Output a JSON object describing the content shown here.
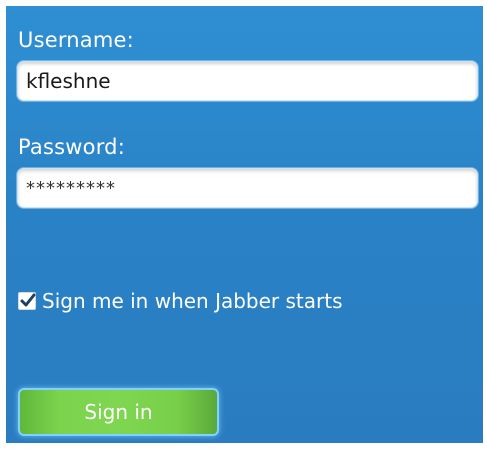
{
  "login": {
    "username_label": "Username:",
    "username_value": "kfleshne",
    "password_label": "Password:",
    "password_value": "*********",
    "remember_label": "Sign me in when Jabber starts",
    "remember_checked": true,
    "signin_label": "Sign in"
  },
  "colors": {
    "panel_bg": "#2f8fd3",
    "button_green": "#7cd34e",
    "text": "#ffffff"
  }
}
